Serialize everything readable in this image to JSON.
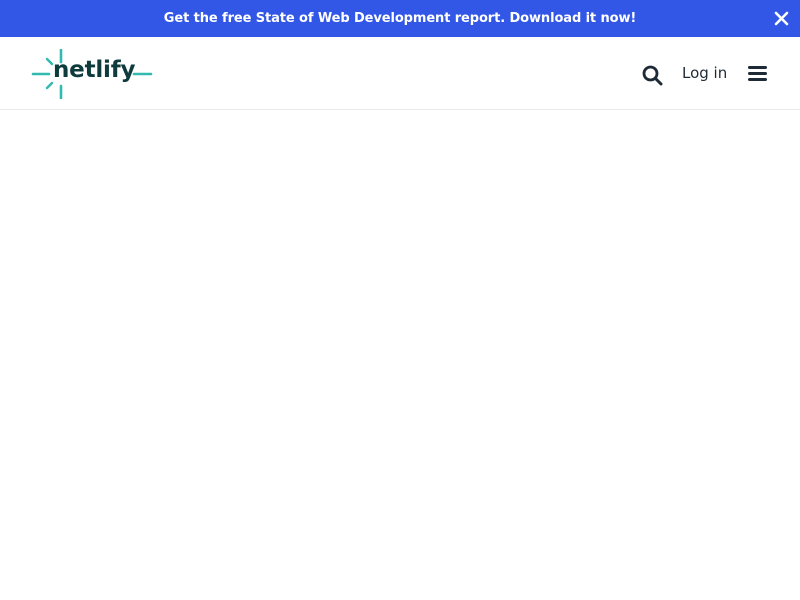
{
  "banner": {
    "text": "Get the free State of Web Development report. Download it now!",
    "close_icon": "close-icon",
    "background_color": "#3257e6"
  },
  "header": {
    "logo_text": "netlify",
    "logo_icon": "netlify-spark-logo",
    "search_icon": "search-icon",
    "login_label": "Log in",
    "menu_icon": "hamburger-menu-icon",
    "brand_teal": "#32b9b0",
    "brand_dark": "#0e3b3b"
  }
}
